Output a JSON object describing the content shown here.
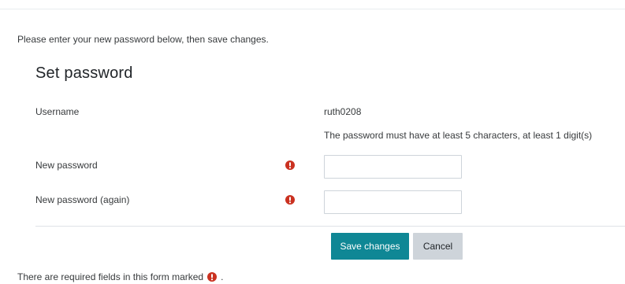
{
  "intro_text": "Please enter your new password below, then save changes.",
  "form": {
    "title": "Set password",
    "username_label": "Username",
    "username_value": "ruth0208",
    "policy_text": "The password must have at least 5 characters, at least 1 digit(s)",
    "new_password_label": "New password",
    "new_password_value": "",
    "new_password_again_label": "New password (again)",
    "new_password_again_value": "",
    "save_label": "Save changes",
    "cancel_label": "Cancel"
  },
  "footer": {
    "required_note_prefix": "There are required fields in this form marked",
    "required_note_suffix": "."
  },
  "icons": {
    "required": "exclamation-circle-icon"
  },
  "colors": {
    "primary": "#0f8795",
    "required_icon": "#ca3120",
    "secondary_button": "#ced4da"
  }
}
